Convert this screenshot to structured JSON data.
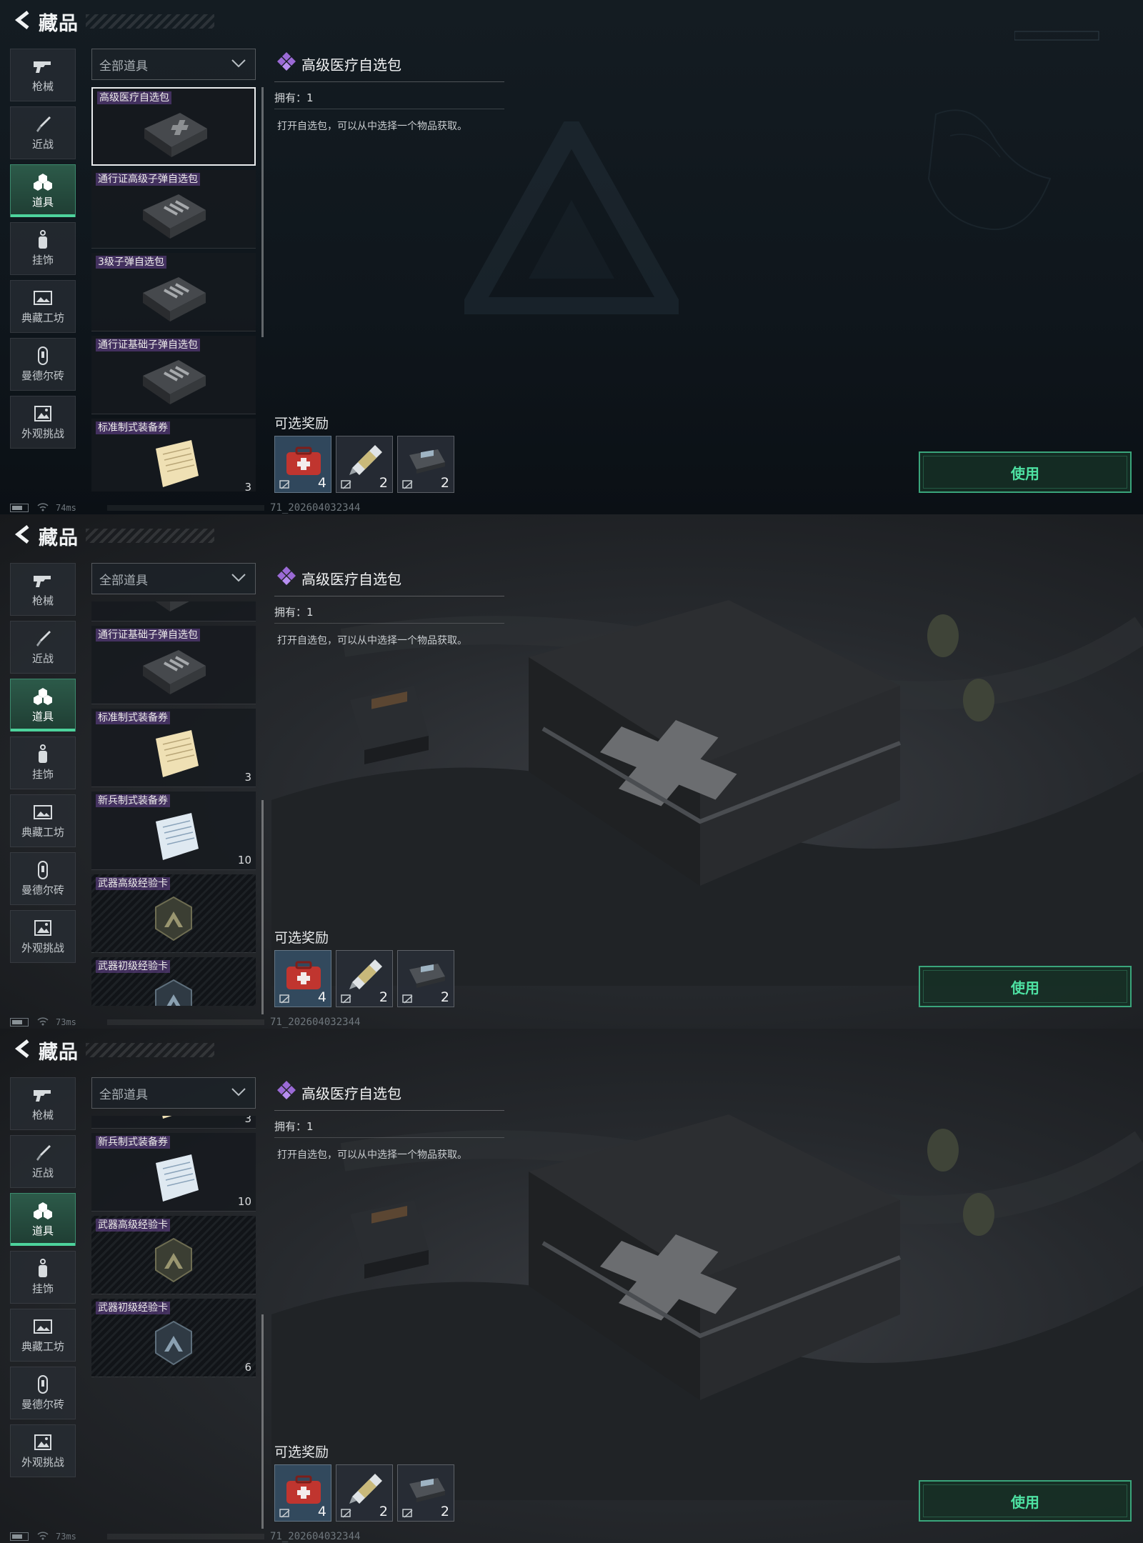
{
  "header": {
    "title": "藏品"
  },
  "nav": [
    {
      "label": "枪械",
      "icon": "gun-icon"
    },
    {
      "label": "近战",
      "icon": "knife-icon"
    },
    {
      "label": "道具",
      "icon": "cubes-icon",
      "active": true
    },
    {
      "label": "挂饰",
      "icon": "charm-icon"
    },
    {
      "label": "典藏工坊",
      "icon": "frame-icon"
    },
    {
      "label": "曼德尔砖",
      "icon": "brick-icon"
    },
    {
      "label": "外观挑战",
      "icon": "image-icon"
    }
  ],
  "filter": {
    "label": "全部道具"
  },
  "items": [
    {
      "name": "高级医疗自选包",
      "kind": "case-medical",
      "count": ""
    },
    {
      "name": "通行证高级子弹自选包",
      "kind": "case-ammo",
      "count": ""
    },
    {
      "name": "3级子弹自选包",
      "kind": "case-ammo",
      "count": ""
    },
    {
      "name": "通行证基础子弹自选包",
      "kind": "case-ammo",
      "count": ""
    },
    {
      "name": "标准制式装备券",
      "kind": "paper-yellow",
      "count": "3"
    },
    {
      "name": "新兵制式装备券",
      "kind": "paper-blue",
      "count": "10"
    },
    {
      "name": "武器高级经验卡",
      "kind": "badge-gold",
      "count": ""
    },
    {
      "name": "武器初级经验卡",
      "kind": "badge-blue",
      "count": "6"
    }
  ],
  "detail": {
    "title": "高级医疗自选包",
    "owned": "拥有：1",
    "description": "打开自选包，可以从中选择一个物品获取。",
    "rewards_label": "可选奖励",
    "rewards": [
      {
        "kind": "medkit",
        "count": "4"
      },
      {
        "kind": "syringe",
        "count": "2"
      },
      {
        "kind": "device",
        "count": "2"
      }
    ],
    "use_label": "使用"
  },
  "screens": [
    {
      "ping": "74ms",
      "build": "71_202604032344",
      "backdrop": "logo"
    },
    {
      "ping": "73ms",
      "build": "71_202604032344",
      "backdrop": "case"
    },
    {
      "ping": "73ms",
      "build": "71_202604032344",
      "backdrop": "case"
    }
  ],
  "colors": {
    "accent_green": "#4ee2a3",
    "rarity_purple": "#9b6ad6",
    "nav_active": "#2c5a49"
  }
}
